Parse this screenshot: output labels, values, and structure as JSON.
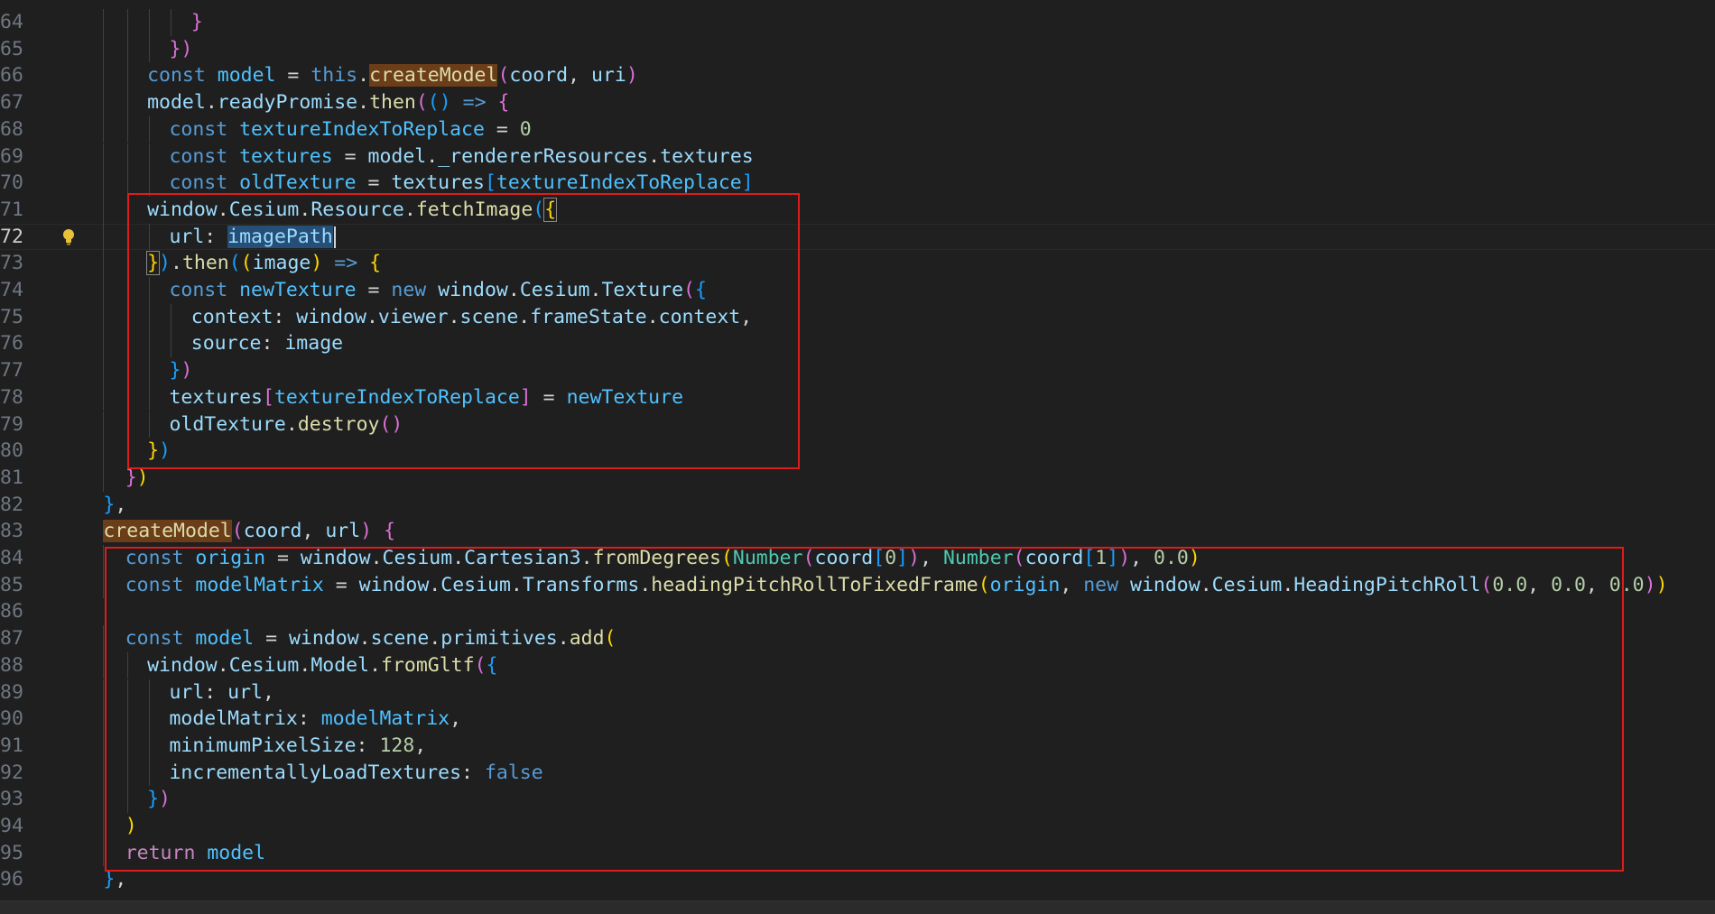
{
  "editor": {
    "active_line": "72",
    "lines": [
      {
        "n": "64",
        "tokens": [
          {
            "t": "}",
            "c": "#da70d6"
          }
        ]
      },
      {
        "n": "65",
        "tokens": [
          {
            "t": "})",
            "c": "#da70d6"
          }
        ]
      },
      {
        "n": "66",
        "tokens": [
          {
            "t": "const ",
            "c": "#569cd6"
          },
          {
            "t": "model",
            "c": "#4fc1ff"
          },
          {
            "t": " = ",
            "c": "#d4d4d4"
          },
          {
            "t": "this",
            "c": "#569cd6"
          },
          {
            "t": ".",
            "c": "#d4d4d4"
          },
          {
            "t": "createModel",
            "c": "#dcdcaa",
            "bg": "#6b3d18"
          },
          {
            "t": "(",
            "c": "#da70d6"
          },
          {
            "t": "coord",
            "c": "#9cdcfe"
          },
          {
            "t": ", ",
            "c": "#d4d4d4"
          },
          {
            "t": "uri",
            "c": "#9cdcfe"
          },
          {
            "t": ")",
            "c": "#da70d6"
          }
        ]
      },
      {
        "n": "67",
        "tokens": [
          {
            "t": "model",
            "c": "#9cdcfe"
          },
          {
            "t": ".",
            "c": "#d4d4d4"
          },
          {
            "t": "readyPromise",
            "c": "#9cdcfe"
          },
          {
            "t": ".",
            "c": "#d4d4d4"
          },
          {
            "t": "then",
            "c": "#dcdcaa"
          },
          {
            "t": "(",
            "c": "#da70d6"
          },
          {
            "t": "() ",
            "c": "#179fff"
          },
          {
            "t": "=>",
            "c": "#569cd6"
          },
          {
            "t": " {",
            "c": "#da70d6"
          }
        ]
      },
      {
        "n": "68",
        "tokens": [
          {
            "t": "const ",
            "c": "#569cd6"
          },
          {
            "t": "textureIndexToReplace",
            "c": "#4fc1ff"
          },
          {
            "t": " = ",
            "c": "#d4d4d4"
          },
          {
            "t": "0",
            "c": "#b5cea8"
          }
        ]
      },
      {
        "n": "69",
        "tokens": [
          {
            "t": "const ",
            "c": "#569cd6"
          },
          {
            "t": "textures",
            "c": "#4fc1ff"
          },
          {
            "t": " = ",
            "c": "#d4d4d4"
          },
          {
            "t": "model",
            "c": "#9cdcfe"
          },
          {
            "t": ".",
            "c": "#d4d4d4"
          },
          {
            "t": "_rendererResources",
            "c": "#9cdcfe"
          },
          {
            "t": ".",
            "c": "#d4d4d4"
          },
          {
            "t": "textures",
            "c": "#9cdcfe"
          }
        ]
      },
      {
        "n": "70",
        "tokens": [
          {
            "t": "const ",
            "c": "#569cd6"
          },
          {
            "t": "oldTexture",
            "c": "#4fc1ff"
          },
          {
            "t": " = ",
            "c": "#d4d4d4"
          },
          {
            "t": "textures",
            "c": "#9cdcfe"
          },
          {
            "t": "[",
            "c": "#179fff"
          },
          {
            "t": "textureIndexToReplace",
            "c": "#4fc1ff"
          },
          {
            "t": "]",
            "c": "#179fff"
          }
        ]
      },
      {
        "n": "71",
        "tokens": [
          {
            "t": "window",
            "c": "#9cdcfe"
          },
          {
            "t": ".",
            "c": "#d4d4d4"
          },
          {
            "t": "Cesium",
            "c": "#9cdcfe"
          },
          {
            "t": ".",
            "c": "#d4d4d4"
          },
          {
            "t": "Resource",
            "c": "#9cdcfe"
          },
          {
            "t": ".",
            "c": "#d4d4d4"
          },
          {
            "t": "fetchImage",
            "c": "#dcdcaa"
          },
          {
            "t": "(",
            "c": "#179fff"
          },
          {
            "t": "{",
            "c": "#ffd700",
            "bm": true
          }
        ]
      },
      {
        "n": "72",
        "tokens": [
          {
            "t": "url",
            "c": "#9cdcfe"
          },
          {
            "t": ": ",
            "c": "#d4d4d4"
          },
          {
            "t": "imagePath",
            "c": "#9cdcfe",
            "sel": true
          }
        ]
      },
      {
        "n": "73",
        "tokens": [
          {
            "t": "}",
            "c": "#ffd700",
            "bm": true
          },
          {
            "t": ")",
            "c": "#179fff"
          },
          {
            "t": ".",
            "c": "#d4d4d4"
          },
          {
            "t": "then",
            "c": "#dcdcaa"
          },
          {
            "t": "(",
            "c": "#179fff"
          },
          {
            "t": "(",
            "c": "#ffd700"
          },
          {
            "t": "image",
            "c": "#9cdcfe"
          },
          {
            "t": ") ",
            "c": "#ffd700"
          },
          {
            "t": "=>",
            "c": "#569cd6"
          },
          {
            "t": " {",
            "c": "#ffd700"
          }
        ]
      },
      {
        "n": "74",
        "tokens": [
          {
            "t": "const ",
            "c": "#569cd6"
          },
          {
            "t": "newTexture",
            "c": "#4fc1ff"
          },
          {
            "t": " = ",
            "c": "#d4d4d4"
          },
          {
            "t": "new ",
            "c": "#569cd6"
          },
          {
            "t": "window",
            "c": "#9cdcfe"
          },
          {
            "t": ".",
            "c": "#d4d4d4"
          },
          {
            "t": "Cesium",
            "c": "#9cdcfe"
          },
          {
            "t": ".",
            "c": "#d4d4d4"
          },
          {
            "t": "Texture",
            "c": "#9cdcfe"
          },
          {
            "t": "(",
            "c": "#da70d6"
          },
          {
            "t": "{",
            "c": "#179fff"
          }
        ]
      },
      {
        "n": "75",
        "tokens": [
          {
            "t": "context",
            "c": "#9cdcfe"
          },
          {
            "t": ": ",
            "c": "#d4d4d4"
          },
          {
            "t": "window",
            "c": "#9cdcfe"
          },
          {
            "t": ".",
            "c": "#d4d4d4"
          },
          {
            "t": "viewer",
            "c": "#9cdcfe"
          },
          {
            "t": ".",
            "c": "#d4d4d4"
          },
          {
            "t": "scene",
            "c": "#9cdcfe"
          },
          {
            "t": ".",
            "c": "#d4d4d4"
          },
          {
            "t": "frameState",
            "c": "#9cdcfe"
          },
          {
            "t": ".",
            "c": "#d4d4d4"
          },
          {
            "t": "context",
            "c": "#9cdcfe"
          },
          {
            "t": ",",
            "c": "#d4d4d4"
          }
        ]
      },
      {
        "n": "76",
        "tokens": [
          {
            "t": "source",
            "c": "#9cdcfe"
          },
          {
            "t": ": ",
            "c": "#d4d4d4"
          },
          {
            "t": "image",
            "c": "#9cdcfe"
          }
        ]
      },
      {
        "n": "77",
        "tokens": [
          {
            "t": "}",
            "c": "#179fff"
          },
          {
            "t": ")",
            "c": "#da70d6"
          }
        ]
      },
      {
        "n": "78",
        "tokens": [
          {
            "t": "textures",
            "c": "#9cdcfe"
          },
          {
            "t": "[",
            "c": "#da70d6"
          },
          {
            "t": "textureIndexToReplace",
            "c": "#4fc1ff"
          },
          {
            "t": "]",
            "c": "#da70d6"
          },
          {
            "t": " = ",
            "c": "#d4d4d4"
          },
          {
            "t": "newTexture",
            "c": "#4fc1ff"
          }
        ]
      },
      {
        "n": "79",
        "tokens": [
          {
            "t": "oldTexture",
            "c": "#9cdcfe"
          },
          {
            "t": ".",
            "c": "#d4d4d4"
          },
          {
            "t": "destroy",
            "c": "#dcdcaa"
          },
          {
            "t": "()",
            "c": "#da70d6"
          }
        ]
      },
      {
        "n": "80",
        "tokens": [
          {
            "t": "}",
            "c": "#ffd700"
          },
          {
            "t": ")",
            "c": "#179fff"
          }
        ]
      },
      {
        "n": "81",
        "tokens": [
          {
            "t": "}",
            "c": "#da70d6"
          },
          {
            "t": ")",
            "c": "#ffd700"
          }
        ]
      },
      {
        "n": "82",
        "tokens": [
          {
            "t": "}",
            "c": "#179fff"
          },
          {
            "t": ",",
            "c": "#d4d4d4"
          }
        ]
      },
      {
        "n": "83",
        "tokens": [
          {
            "t": "createModel",
            "c": "#dcdcaa",
            "bg": "#6b3d18"
          },
          {
            "t": "(",
            "c": "#da70d6"
          },
          {
            "t": "coord",
            "c": "#9cdcfe"
          },
          {
            "t": ", ",
            "c": "#d4d4d4"
          },
          {
            "t": "url",
            "c": "#9cdcfe"
          },
          {
            "t": ")",
            "c": "#da70d6"
          },
          {
            "t": " {",
            "c": "#da70d6"
          }
        ]
      },
      {
        "n": "84",
        "tokens": [
          {
            "t": "const ",
            "c": "#569cd6"
          },
          {
            "t": "origin",
            "c": "#4fc1ff"
          },
          {
            "t": " = ",
            "c": "#d4d4d4"
          },
          {
            "t": "window",
            "c": "#9cdcfe"
          },
          {
            "t": ".",
            "c": "#d4d4d4"
          },
          {
            "t": "Cesium",
            "c": "#9cdcfe"
          },
          {
            "t": ".",
            "c": "#d4d4d4"
          },
          {
            "t": "Cartesian3",
            "c": "#9cdcfe"
          },
          {
            "t": ".",
            "c": "#d4d4d4"
          },
          {
            "t": "fromDegrees",
            "c": "#dcdcaa"
          },
          {
            "t": "(",
            "c": "#ffd700"
          },
          {
            "t": "Number",
            "c": "#4ec9b0"
          },
          {
            "t": "(",
            "c": "#da70d6"
          },
          {
            "t": "coord",
            "c": "#9cdcfe"
          },
          {
            "t": "[",
            "c": "#179fff"
          },
          {
            "t": "0",
            "c": "#b5cea8"
          },
          {
            "t": "]",
            "c": "#179fff"
          },
          {
            "t": ")",
            "c": "#da70d6"
          },
          {
            "t": ", ",
            "c": "#d4d4d4"
          },
          {
            "t": "Number",
            "c": "#4ec9b0"
          },
          {
            "t": "(",
            "c": "#da70d6"
          },
          {
            "t": "coord",
            "c": "#9cdcfe"
          },
          {
            "t": "[",
            "c": "#179fff"
          },
          {
            "t": "1",
            "c": "#b5cea8"
          },
          {
            "t": "]",
            "c": "#179fff"
          },
          {
            "t": ")",
            "c": "#da70d6"
          },
          {
            "t": ", ",
            "c": "#d4d4d4"
          },
          {
            "t": "0.0",
            "c": "#b5cea8"
          },
          {
            "t": ")",
            "c": "#ffd700"
          }
        ]
      },
      {
        "n": "85",
        "tokens": [
          {
            "t": "const ",
            "c": "#569cd6"
          },
          {
            "t": "modelMatrix",
            "c": "#4fc1ff"
          },
          {
            "t": " = ",
            "c": "#d4d4d4"
          },
          {
            "t": "window",
            "c": "#9cdcfe"
          },
          {
            "t": ".",
            "c": "#d4d4d4"
          },
          {
            "t": "Cesium",
            "c": "#9cdcfe"
          },
          {
            "t": ".",
            "c": "#d4d4d4"
          },
          {
            "t": "Transforms",
            "c": "#9cdcfe"
          },
          {
            "t": ".",
            "c": "#d4d4d4"
          },
          {
            "t": "headingPitchRollToFixedFrame",
            "c": "#dcdcaa"
          },
          {
            "t": "(",
            "c": "#ffd700"
          },
          {
            "t": "origin",
            "c": "#4fc1ff"
          },
          {
            "t": ", ",
            "c": "#d4d4d4"
          },
          {
            "t": "new ",
            "c": "#569cd6"
          },
          {
            "t": "window",
            "c": "#9cdcfe"
          },
          {
            "t": ".",
            "c": "#d4d4d4"
          },
          {
            "t": "Cesium",
            "c": "#9cdcfe"
          },
          {
            "t": ".",
            "c": "#d4d4d4"
          },
          {
            "t": "HeadingPitchRoll",
            "c": "#9cdcfe"
          },
          {
            "t": "(",
            "c": "#da70d6"
          },
          {
            "t": "0.0",
            "c": "#b5cea8"
          },
          {
            "t": ", ",
            "c": "#d4d4d4"
          },
          {
            "t": "0.0",
            "c": "#b5cea8"
          },
          {
            "t": ", ",
            "c": "#d4d4d4"
          },
          {
            "t": "0.0",
            "c": "#b5cea8"
          },
          {
            "t": ")",
            "c": "#da70d6"
          },
          {
            "t": ")",
            "c": "#ffd700"
          }
        ]
      },
      {
        "n": "86",
        "tokens": []
      },
      {
        "n": "87",
        "tokens": [
          {
            "t": "const ",
            "c": "#569cd6"
          },
          {
            "t": "model",
            "c": "#4fc1ff"
          },
          {
            "t": " = ",
            "c": "#d4d4d4"
          },
          {
            "t": "window",
            "c": "#9cdcfe"
          },
          {
            "t": ".",
            "c": "#d4d4d4"
          },
          {
            "t": "scene",
            "c": "#9cdcfe"
          },
          {
            "t": ".",
            "c": "#d4d4d4"
          },
          {
            "t": "primitives",
            "c": "#9cdcfe"
          },
          {
            "t": ".",
            "c": "#d4d4d4"
          },
          {
            "t": "add",
            "c": "#dcdcaa"
          },
          {
            "t": "(",
            "c": "#ffd700"
          }
        ]
      },
      {
        "n": "88",
        "tokens": [
          {
            "t": "window",
            "c": "#9cdcfe"
          },
          {
            "t": ".",
            "c": "#d4d4d4"
          },
          {
            "t": "Cesium",
            "c": "#9cdcfe"
          },
          {
            "t": ".",
            "c": "#d4d4d4"
          },
          {
            "t": "Model",
            "c": "#9cdcfe"
          },
          {
            "t": ".",
            "c": "#d4d4d4"
          },
          {
            "t": "fromGltf",
            "c": "#dcdcaa"
          },
          {
            "t": "(",
            "c": "#da70d6"
          },
          {
            "t": "{",
            "c": "#179fff"
          }
        ]
      },
      {
        "n": "89",
        "tokens": [
          {
            "t": "url",
            "c": "#9cdcfe"
          },
          {
            "t": ": ",
            "c": "#d4d4d4"
          },
          {
            "t": "url",
            "c": "#9cdcfe"
          },
          {
            "t": ",",
            "c": "#d4d4d4"
          }
        ]
      },
      {
        "n": "90",
        "tokens": [
          {
            "t": "modelMatrix",
            "c": "#9cdcfe"
          },
          {
            "t": ": ",
            "c": "#d4d4d4"
          },
          {
            "t": "modelMatrix",
            "c": "#4fc1ff"
          },
          {
            "t": ",",
            "c": "#d4d4d4"
          }
        ]
      },
      {
        "n": "91",
        "tokens": [
          {
            "t": "minimumPixelSize",
            "c": "#9cdcfe"
          },
          {
            "t": ": ",
            "c": "#d4d4d4"
          },
          {
            "t": "128",
            "c": "#b5cea8"
          },
          {
            "t": ",",
            "c": "#d4d4d4"
          }
        ]
      },
      {
        "n": "92",
        "tokens": [
          {
            "t": "incrementallyLoadTextures",
            "c": "#9cdcfe"
          },
          {
            "t": ": ",
            "c": "#d4d4d4"
          },
          {
            "t": "false",
            "c": "#569cd6"
          }
        ]
      },
      {
        "n": "93",
        "tokens": [
          {
            "t": "}",
            "c": "#179fff"
          },
          {
            "t": ")",
            "c": "#da70d6"
          }
        ]
      },
      {
        "n": "94",
        "tokens": [
          {
            "t": ")",
            "c": "#ffd700"
          }
        ]
      },
      {
        "n": "95",
        "tokens": [
          {
            "t": "return ",
            "c": "#c586c0"
          },
          {
            "t": "model",
            "c": "#4fc1ff"
          }
        ]
      },
      {
        "n": "96",
        "tokens": [
          {
            "t": "}",
            "c": "#179fff"
          },
          {
            "t": ",",
            "c": "#d4d4d4"
          }
        ]
      }
    ]
  },
  "colors": {
    "background": "#1f1f1f",
    "highlight_box": "#e01b1b",
    "lightbulb": "#e8c13a"
  },
  "icons": {
    "gutter": "lightbulb-icon"
  }
}
